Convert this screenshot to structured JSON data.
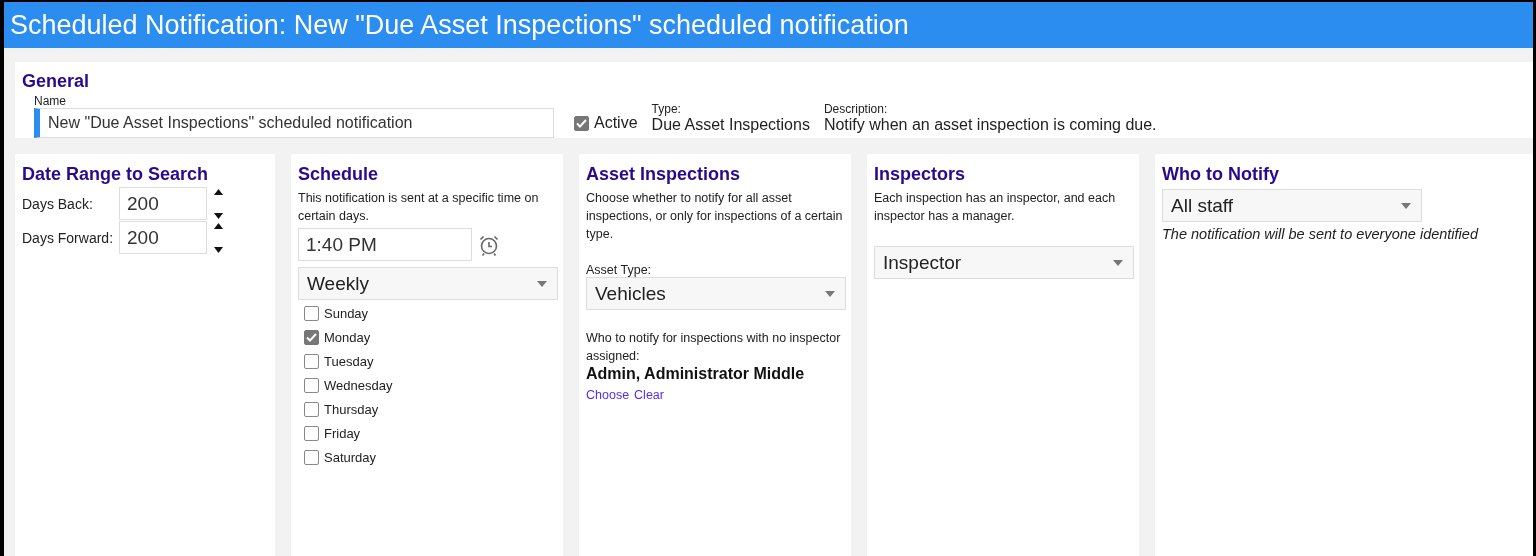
{
  "window": {
    "title": "Scheduled Notification: New \"Due Asset Inspections\" scheduled notification"
  },
  "general": {
    "heading": "General",
    "name_label": "Name",
    "name_value": "New \"Due Asset Inspections\" scheduled notification",
    "active": {
      "label": "Active",
      "checked": true
    },
    "type_label": "Type:",
    "type_value": "Due Asset Inspections",
    "description_label": "Description:",
    "description_value": "Notify when an asset inspection is coming due."
  },
  "date_range": {
    "heading": "Date Range to Search",
    "fields": [
      {
        "label": "Days Back:",
        "value": "200"
      },
      {
        "label": "Days Forward:",
        "value": "200"
      }
    ]
  },
  "schedule": {
    "heading": "Schedule",
    "note": "This notification is sent at a specific time on certain days.",
    "time": "1:40 PM",
    "frequency": "Weekly",
    "days": [
      {
        "label": "Sunday",
        "checked": false
      },
      {
        "label": "Monday",
        "checked": true
      },
      {
        "label": "Tuesday",
        "checked": false
      },
      {
        "label": "Wednesday",
        "checked": false
      },
      {
        "label": "Thursday",
        "checked": false
      },
      {
        "label": "Friday",
        "checked": false
      },
      {
        "label": "Saturday",
        "checked": false
      }
    ]
  },
  "asset_inspections": {
    "heading": "Asset Inspections",
    "note": "Choose whether to notify for all asset inspections, or only for inspections of a certain type.",
    "asset_type_label": "Asset Type:",
    "asset_type": "Vehicles",
    "fallback_label": "Who to notify for inspections with no inspector assigned:",
    "fallback_person": "Admin, Administrator Middle",
    "links": [
      "Choose",
      "Clear"
    ]
  },
  "inspectors": {
    "heading": "Inspectors",
    "note": "Each inspection has an inspector, and each inspector has a manager.",
    "role": "Inspector"
  },
  "who_to_notify": {
    "heading": "Who to Notify",
    "recipient": "All staff",
    "note": "The notification will be sent to everyone identified"
  }
}
